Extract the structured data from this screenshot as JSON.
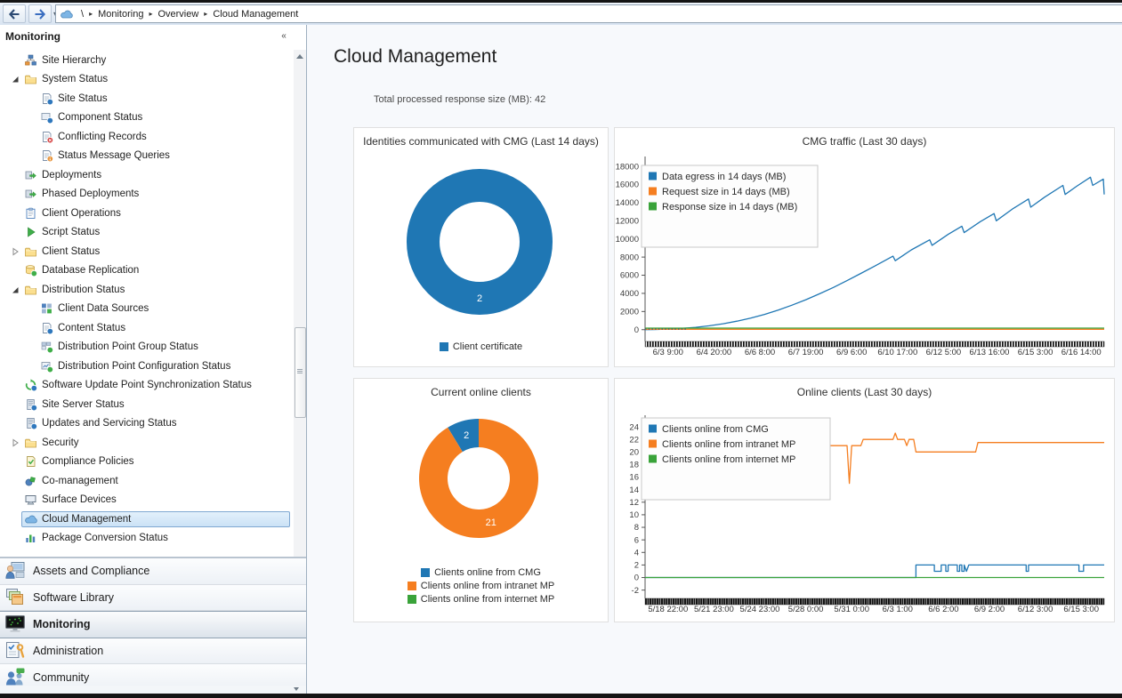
{
  "toolbar": {
    "breadcrumb": {
      "segments": [
        "\\",
        "Monitoring",
        "Overview",
        "Cloud Management"
      ]
    }
  },
  "sidebar": {
    "header": "Monitoring",
    "tree": [
      {
        "label": "Site Hierarchy",
        "icon": "site-hierarchy",
        "level": 1
      },
      {
        "label": "System Status",
        "icon": "folder",
        "level": 1,
        "expand": "expanded"
      },
      {
        "label": "Site Status",
        "icon": "site-status",
        "level": 2
      },
      {
        "label": "Component Status",
        "icon": "component-status",
        "level": 2
      },
      {
        "label": "Conflicting Records",
        "icon": "conflicting-records",
        "level": 2
      },
      {
        "label": "Status Message Queries",
        "icon": "status-message-queries",
        "level": 2
      },
      {
        "label": "Deployments",
        "icon": "deployments",
        "level": 1
      },
      {
        "label": "Phased Deployments",
        "icon": "phased-deployments",
        "level": 1
      },
      {
        "label": "Client Operations",
        "icon": "client-operations",
        "level": 1
      },
      {
        "label": "Script Status",
        "icon": "script-status",
        "level": 1
      },
      {
        "label": "Client Status",
        "icon": "folder",
        "level": 1,
        "expand": "collapsed"
      },
      {
        "label": "Database Replication",
        "icon": "database-replication",
        "level": 1
      },
      {
        "label": "Distribution Status",
        "icon": "folder",
        "level": 1,
        "expand": "expanded"
      },
      {
        "label": "Client Data Sources",
        "icon": "client-data-sources",
        "level": 2
      },
      {
        "label": "Content Status",
        "icon": "content-status",
        "level": 2
      },
      {
        "label": "Distribution Point Group Status",
        "icon": "dp-group-status",
        "level": 2
      },
      {
        "label": "Distribution Point Configuration Status",
        "icon": "dp-config-status",
        "level": 2
      },
      {
        "label": "Software Update Point Synchronization Status",
        "icon": "sup-sync-status",
        "level": 1
      },
      {
        "label": "Site Server Status",
        "icon": "site-server-status",
        "level": 1
      },
      {
        "label": "Updates and Servicing Status",
        "icon": "updates-servicing-status",
        "level": 1
      },
      {
        "label": "Security",
        "icon": "folder",
        "level": 1,
        "expand": "collapsed"
      },
      {
        "label": "Compliance Policies",
        "icon": "compliance-policies",
        "level": 1
      },
      {
        "label": "Co-management",
        "icon": "co-management",
        "level": 1
      },
      {
        "label": "Surface Devices",
        "icon": "surface-devices",
        "level": 1
      },
      {
        "label": "Cloud Management",
        "icon": "cloud",
        "level": 1,
        "selected": true
      },
      {
        "label": "Package Conversion Status",
        "icon": "package-conversion-status",
        "level": 1
      }
    ],
    "workspaces": [
      {
        "label": "Assets and Compliance",
        "icon": "assets-compliance"
      },
      {
        "label": "Software Library",
        "icon": "software-library"
      },
      {
        "label": "Monitoring",
        "icon": "monitoring",
        "selected": true
      },
      {
        "label": "Administration",
        "icon": "administration"
      },
      {
        "label": "Community",
        "icon": "community"
      }
    ]
  },
  "main": {
    "title": "Cloud Management",
    "stat_line": "Total processed response size (MB): 42"
  },
  "colors": {
    "blue": "#1f77b4",
    "orange": "#f57e20",
    "green": "#3aa33a"
  },
  "chart_data": [
    {
      "type": "donut",
      "title": "Identities communicated with CMG (Last 14 days)",
      "rotation": 0,
      "slices": [
        {
          "label": "Client certificate",
          "value": 2,
          "color": "#1f77b4",
          "value_label": "2"
        }
      ]
    },
    {
      "type": "line",
      "title": "CMG traffic (Last 30 days)",
      "ylim": [
        -1300,
        18500
      ],
      "yticks": [
        18000,
        16000,
        14000,
        12000,
        10000,
        8000,
        6000,
        4000,
        2000,
        0
      ],
      "xlabels": [
        "6/3 9:00",
        "6/4 20:00",
        "6/6 8:00",
        "6/7 19:00",
        "6/9 6:00",
        "6/10 17:00",
        "6/12 5:00",
        "6/13 16:00",
        "6/15 3:00",
        "6/16 14:00"
      ],
      "series": [
        {
          "name": "Data egress in 14 days (MB)",
          "color": "#1f77b4",
          "points": [
            [
              0,
              0
            ],
            [
              2,
              15
            ],
            [
              5,
              60
            ],
            [
              8,
              140
            ],
            [
              11,
              260
            ],
            [
              14,
              430
            ],
            [
              17,
              650
            ],
            [
              20,
              930
            ],
            [
              23,
              1270
            ],
            [
              26,
              1680
            ],
            [
              29,
              2160
            ],
            [
              32,
              2700
            ],
            [
              35,
              3300
            ],
            [
              38,
              3950
            ],
            [
              41,
              4650
            ],
            [
              44,
              5400
            ],
            [
              47,
              6200
            ],
            [
              50,
              7000
            ],
            [
              54,
              8100
            ],
            [
              54.5,
              7600
            ],
            [
              58,
              8800
            ],
            [
              62,
              9900
            ],
            [
              62.5,
              9300
            ],
            [
              66,
              10500
            ],
            [
              69,
              11400
            ],
            [
              69.5,
              10700
            ],
            [
              73,
              11900
            ],
            [
              76,
              12800
            ],
            [
              76.5,
              12000
            ],
            [
              80,
              13300
            ],
            [
              83.5,
              14400
            ],
            [
              84,
              13500
            ],
            [
              87,
              14600
            ],
            [
              91,
              15900
            ],
            [
              91.5,
              14900
            ],
            [
              94,
              15800
            ],
            [
              97,
              16800
            ],
            [
              97.5,
              15900
            ],
            [
              99.8,
              16600
            ],
            [
              100,
              14900
            ]
          ]
        },
        {
          "name": "Request size in 14 days (MB)",
          "color": "#f57e20",
          "points": [
            [
              0,
              40
            ],
            [
              100,
              40
            ]
          ]
        },
        {
          "name": "Response size in 14 days (MB)",
          "color": "#3aa33a",
          "points": [
            [
              0,
              170
            ],
            [
              100,
              170
            ]
          ]
        },
        {
          "name": "baseline-dotted",
          "color": "#3a5a78",
          "legend": false,
          "dash": true,
          "points": [
            [
              0,
              60
            ],
            [
              9,
              60
            ]
          ]
        }
      ]
    },
    {
      "type": "donut",
      "title": "Current online clients",
      "rotation": -31.3,
      "slices": [
        {
          "label": "Clients online from CMG",
          "value": 2,
          "color": "#1f77b4",
          "value_label": "2"
        },
        {
          "label": "Clients online from intranet MP",
          "value": 21,
          "color": "#f57e20",
          "value_label": "21"
        },
        {
          "label": "Clients online from internet MP",
          "value": 0,
          "color": "#3aa33a"
        }
      ]
    },
    {
      "type": "line",
      "title": "Online clients (Last 30 days)",
      "ylim": [
        -2.9,
        25
      ],
      "yticks": [
        24,
        22,
        20,
        18,
        16,
        14,
        12,
        10,
        8,
        6,
        4,
        2,
        0,
        -2
      ],
      "xlabels": [
        "5/18 22:00",
        "5/21 23:00",
        "5/24 23:00",
        "5/28 0:00",
        "5/31 0:00",
        "6/3 1:00",
        "6/6 2:00",
        "6/9 2:00",
        "6/12 3:00",
        "6/15 3:00"
      ],
      "series": [
        {
          "name": "Clients online from CMG",
          "color": "#1f77b4",
          "points": [
            [
              0,
              0
            ],
            [
              59,
              0
            ],
            [
              59,
              2
            ],
            [
              63,
              2
            ],
            [
              63,
              1
            ],
            [
              64.5,
              1
            ],
            [
              64.5,
              2
            ],
            [
              65.5,
              2
            ],
            [
              65.5,
              1
            ],
            [
              66,
              1
            ],
            [
              66,
              2
            ],
            [
              68,
              2
            ],
            [
              68,
              1
            ],
            [
              68.5,
              1
            ],
            [
              68.5,
              2
            ],
            [
              69,
              2
            ],
            [
              69,
              1
            ],
            [
              69.5,
              1
            ],
            [
              69.5,
              2
            ],
            [
              70,
              1
            ],
            [
              70.5,
              2
            ],
            [
              83,
              2
            ],
            [
              83,
              1
            ],
            [
              83.5,
              1
            ],
            [
              83.5,
              2
            ],
            [
              94.5,
              2
            ],
            [
              94.5,
              1
            ],
            [
              95.5,
              1
            ],
            [
              95.5,
              2
            ],
            [
              100,
              2
            ]
          ]
        },
        {
          "name": "Clients online from intranet MP",
          "color": "#f57e20",
          "points": [
            [
              0,
              21
            ],
            [
              44,
              21
            ],
            [
              44.5,
              15
            ],
            [
              45,
              21
            ],
            [
              47,
              21
            ],
            [
              47.5,
              22
            ],
            [
              54,
              22
            ],
            [
              54.5,
              23
            ],
            [
              55,
              22
            ],
            [
              56.5,
              22
            ],
            [
              57,
              21
            ],
            [
              57.5,
              22
            ],
            [
              58.5,
              22
            ],
            [
              59,
              20
            ],
            [
              72,
              20
            ],
            [
              72.5,
              21.5
            ],
            [
              100,
              21.5
            ]
          ]
        },
        {
          "name": "Clients online from internet MP",
          "color": "#3aa33a",
          "points": [
            [
              0,
              0
            ],
            [
              100,
              0
            ]
          ]
        }
      ]
    }
  ]
}
